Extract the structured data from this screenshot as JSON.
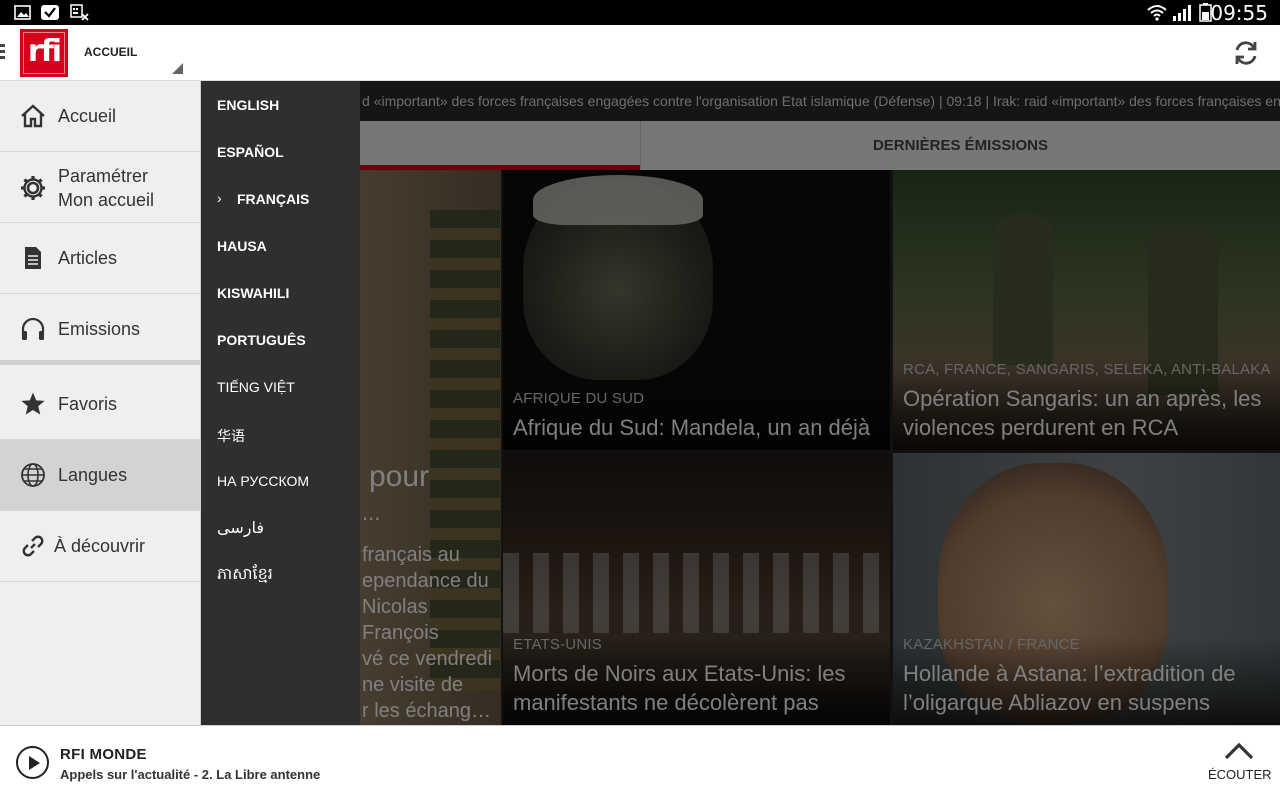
{
  "status_bar": {
    "time": "09:55",
    "left_icons": [
      "image-icon",
      "check-icon",
      "keyboard-off-icon"
    ],
    "right_icons": [
      "wifi-icon",
      "signal-icon",
      "battery-icon"
    ]
  },
  "app_bar": {
    "logo_text": "rfi",
    "section_title": "ACCUEIL",
    "brand_color": "#d6001c"
  },
  "ticker": {
    "text": "d «important» des forces françaises engagées contre l'organisation Etat islamique (Défense) | 09:18 | Irak: raid «important» des forces françaises engagées"
  },
  "tabs": [
    {
      "label": "",
      "active": true
    },
    {
      "label": "DERNIÈRES ÉMISSIONS",
      "active": false
    }
  ],
  "left_feature": {
    "title_fragment": "pour",
    "ellipsis": "...",
    "lines": [
      "français au",
      "ependance du",
      "Nicolas",
      "François",
      "vé ce vendredi",
      "ne visite de",
      "r les échang…"
    ]
  },
  "cards": [
    {
      "tag": "AFRIQUE DU SUD",
      "title": "Afrique du Sud: Mandela, un an déjà"
    },
    {
      "tag": "RCA, FRANCE, SANGARIS, SELEKA, ANTI-BALAKA",
      "title": "Opération Sangaris: un an après, les violences perdurent en RCA"
    },
    {
      "tag": "ETATS-UNIS",
      "title": "Morts de Noirs aux Etats-Unis: les manifestants ne décolèrent pas"
    },
    {
      "tag": "KAZAKHSTAN / FRANCE",
      "title": "Hollande à Astana: l’extradition de l’oligarque Abliazov en suspens"
    }
  ],
  "drawer": {
    "items": [
      {
        "label": "Accueil",
        "icon": "home-icon"
      },
      {
        "label": "Paramétrer\nMon accueil",
        "label_line1": "Paramétrer",
        "label_line2": "Mon accueil",
        "icon": "gear-icon"
      },
      {
        "label": "Articles",
        "icon": "document-icon"
      },
      {
        "label": "Emissions",
        "icon": "headphones-icon"
      },
      {
        "label": "Favoris",
        "icon": "star-icon"
      },
      {
        "label": "Langues",
        "icon": "globe-icon",
        "selected": true
      },
      {
        "label": "À découvrir",
        "icon": "link-icon"
      }
    ]
  },
  "languages": [
    {
      "label": "ENGLISH"
    },
    {
      "label": "ESPAÑOL"
    },
    {
      "label": "FRANÇAIS",
      "current": true,
      "marker": "›"
    },
    {
      "label": "HAUSA"
    },
    {
      "label": "KISWAHILI"
    },
    {
      "label": "PORTUGUÊS"
    },
    {
      "label": "TIẾNG VIỆT"
    },
    {
      "label": "华语"
    },
    {
      "label": "НА РУССКОМ"
    },
    {
      "label": "فارسی"
    },
    {
      "label": "ភាសាខ្មែរ"
    }
  ],
  "player": {
    "station": "RFI MONDE",
    "program": "Appels sur l'actualité - 2. La Libre antenne",
    "listen_label": "ÉCOUTER"
  }
}
